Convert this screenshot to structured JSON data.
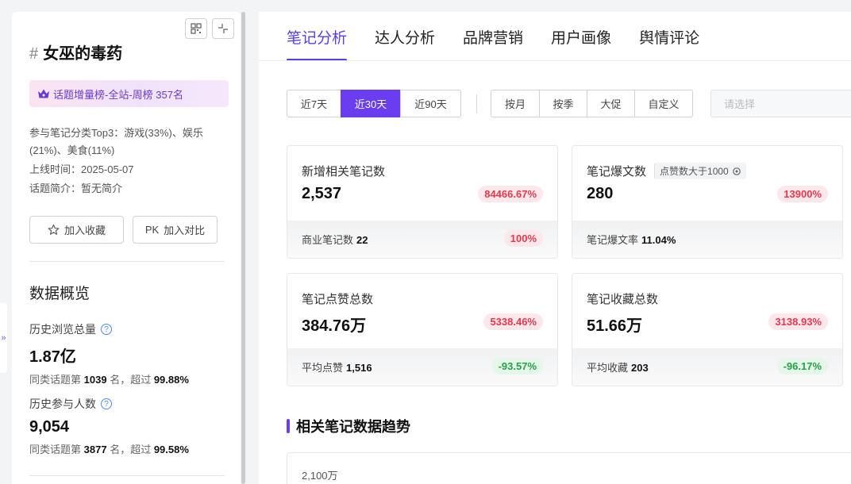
{
  "sidebar": {
    "topic_title": "女巫的毒药",
    "hash": "#",
    "rank_badge": "话题增量榜-全站-周榜 357名",
    "category_line": "参与笔记分类Top3：游戏(33%)、娱乐(21%)、美食(11%)",
    "online_time": "上线时间：2025-05-07",
    "intro": "话题简介：暂无简介",
    "fav_button": "加入收藏",
    "compare_button": "加入对比",
    "compare_prefix": "PK",
    "overview_title": "数据概览",
    "stats": [
      {
        "label": "历史浏览总量",
        "value": "1.87亿",
        "rank_prefix": "同类话题第",
        "rank": "1039",
        "mid": "名，超过",
        "percent": "99.88%"
      },
      {
        "label": "历史参与人数",
        "value": "9,054",
        "rank_prefix": "同类话题第",
        "rank": "3877",
        "mid": "名，超过",
        "percent": "99.58%"
      }
    ]
  },
  "tabs": [
    "笔记分析",
    "达人分析",
    "品牌营销",
    "用户画像",
    "舆情评论"
  ],
  "filters": {
    "range": [
      "近7天",
      "近30天",
      "近90天"
    ],
    "range_active": 1,
    "period": [
      "按月",
      "按季",
      "大促",
      "自定义"
    ],
    "select_placeholder": "请选择"
  },
  "cards": [
    {
      "title": "新增相关笔记数",
      "value": "2,537",
      "change": "84466.67%",
      "change_color": "red",
      "sub_label": "商业笔记数",
      "sub_value": "22",
      "sub_change": "100%",
      "sub_change_color": "red"
    },
    {
      "title": "笔记爆文数",
      "tag": "点赞数大于1000",
      "value": "280",
      "change": "13900%",
      "change_color": "red",
      "sub_label": "笔记爆文率",
      "sub_value": "11.04%"
    },
    {
      "title": "笔记点赞总数",
      "value": "384.76万",
      "change": "5338.46%",
      "change_color": "red",
      "sub_label": "平均点赞",
      "sub_value": "1,516",
      "sub_change": "-93.57%",
      "sub_change_color": "green"
    },
    {
      "title": "笔记收藏总数",
      "value": "51.66万",
      "change": "3138.93%",
      "change_color": "red",
      "sub_label": "平均收藏",
      "sub_value": "203",
      "sub_change": "-96.17%",
      "sub_change_color": "green"
    }
  ],
  "trend": {
    "title": "相关笔记数据趋势",
    "y_top_label": "2,100万"
  }
}
